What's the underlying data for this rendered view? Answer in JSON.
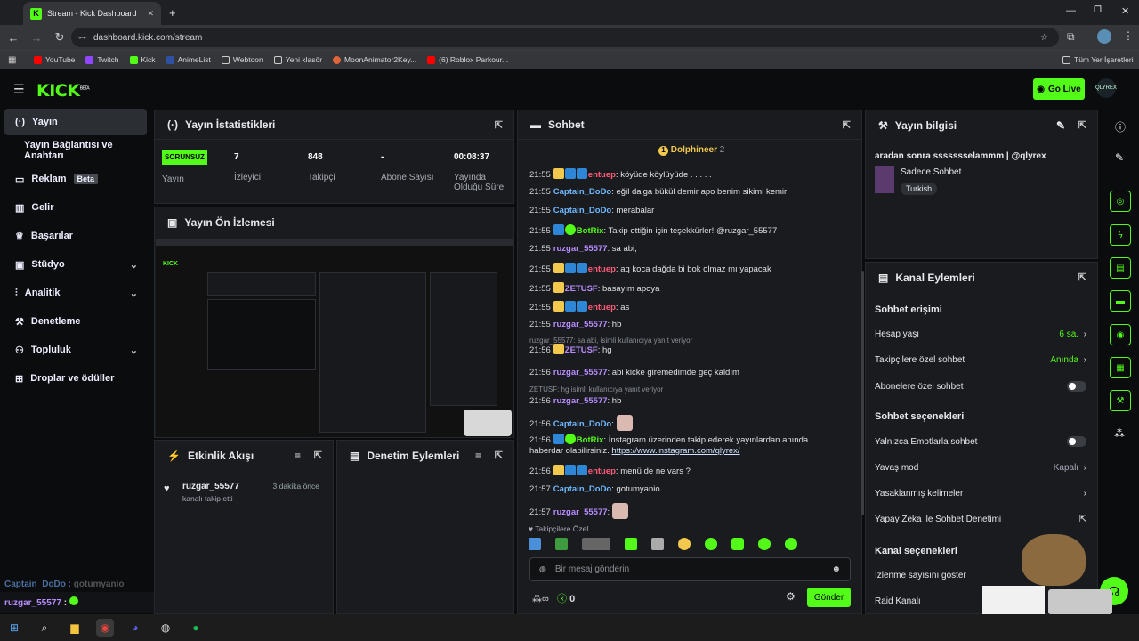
{
  "browser": {
    "tab_title": "Stream - Kick Dashboard",
    "url": "dashboard.kick.com/stream",
    "bookmarks": [
      {
        "label": "YouTube",
        "color": "#ff0000"
      },
      {
        "label": "Twitch",
        "color": "#9146ff"
      },
      {
        "label": "Kick",
        "color": "#53fc18"
      },
      {
        "label": "AnimeList",
        "color": "#2e51a2"
      },
      {
        "label": "Webtoon",
        "color": "#cccccc"
      },
      {
        "label": "Yeni klasör",
        "color": "#cccccc"
      },
      {
        "label": "MoonAnimator2Key...",
        "color": "#e0663a"
      },
      {
        "label": "(6) Roblox Parkour...",
        "color": "#ff0000"
      }
    ],
    "all_bookmarks": "Tüm Yer İşaretleri"
  },
  "header": {
    "logo": "KICK",
    "logo_sup": "BETA",
    "go_live": "Go Live",
    "avatar": "QLYREX"
  },
  "sidebar": {
    "items": [
      {
        "label": "Yayın",
        "icon": "broadcast-icon"
      },
      {
        "label": "Yayın Bağlantısı ve Anahtarı",
        "icon": ""
      },
      {
        "label": "Reklam",
        "icon": "ad-icon",
        "beta": "Beta"
      },
      {
        "label": "Gelir",
        "icon": "chart-icon"
      },
      {
        "label": "Başarılar",
        "icon": "trophy-icon"
      },
      {
        "label": "Stüdyo",
        "icon": "studio-icon"
      },
      {
        "label": "Analitik",
        "icon": "analytics-icon"
      },
      {
        "label": "Denetleme",
        "icon": "wrench-icon"
      },
      {
        "label": "Topluluk",
        "icon": "community-icon"
      },
      {
        "label": "Droplar ve ödüller",
        "icon": "gift-icon"
      }
    ],
    "chat_overlay": [
      {
        "user": "Captain_DoDo",
        "text": "gotumyanio"
      },
      {
        "user": "ruzgar_55577",
        "text": ":"
      }
    ]
  },
  "stats": {
    "title": "Yayın İstatistikleri",
    "status_badge": "SORUNSUZ",
    "status_label": "Yayın",
    "viewers": "7",
    "viewers_label": "İzleyici",
    "followers": "848",
    "followers_label": "Takipçi",
    "subs": "-",
    "subs_label": "Abone Sayısı",
    "duration": "00:08:37",
    "duration_label": "Yayında Olduğu Süre"
  },
  "preview": {
    "title": "Yayın Ön İzlemesi"
  },
  "activity": {
    "title": "Etkinlik Akışı",
    "events": [
      {
        "user": "ruzgar_55577",
        "action": "kanalı takip etti",
        "time": "3 dakika önce"
      }
    ]
  },
  "moderation": {
    "title": "Denetim Eylemleri"
  },
  "chat": {
    "title": "Sohbet",
    "pinned_user": "Dolphineer",
    "pinned_count": "2",
    "pinned_rank": "1",
    "messages": [
      {
        "time": "21:55",
        "user": "entuep",
        "text": "köyüde köylüyüde . . . . . .",
        "cls": "u1"
      },
      {
        "time": "21:55",
        "user": "Captain_DoDo",
        "text": "eğil dalga bükül demir apo benim sikimi kemir",
        "cls": "u2"
      },
      {
        "time": "21:55",
        "user": "Captain_DoDo",
        "text": "merabalar",
        "cls": "u2"
      },
      {
        "time": "21:55",
        "user": "BotRix",
        "text": "Takip ettiğin için teşekkürler! @ruzgar_55577",
        "cls": "u4"
      },
      {
        "time": "21:55",
        "user": "ruzgar_55577",
        "text": "sa abi,",
        "cls": "u3"
      },
      {
        "time": "21:55",
        "user": "entuep",
        "text": "aq koca dağda bi bok olmaz mı yapacak",
        "cls": "u1"
      },
      {
        "time": "21:55",
        "user": "ZETUSF",
        "text": "basayım apoya",
        "cls": "u3"
      },
      {
        "time": "21:55",
        "user": "entuep",
        "text": "as",
        "cls": "u1"
      },
      {
        "time": "21:55",
        "user": "ruzgar_55577",
        "text": "hb",
        "cls": "u3"
      },
      {
        "time": "21:56",
        "user": "ZETUSF",
        "text": "hg",
        "cls": "u3",
        "reply": "ruzgar_55577: sa abi, isimli kullanıcıya yanıt veriyor"
      },
      {
        "time": "21:56",
        "user": "ruzgar_55577",
        "text": "abi kicke giremedimde geç kaldım",
        "cls": "u3"
      },
      {
        "time": "21:56",
        "user": "ruzgar_55577",
        "text": "hb",
        "cls": "u3",
        "reply": "ZETUSF: hg isimli kullanıcıya yanıt veriyor"
      },
      {
        "time": "21:56",
        "user": "Captain_DoDo",
        "text": "",
        "cls": "u2"
      },
      {
        "time": "21:56",
        "user": "BotRix",
        "text": "İnstagram üzerinden takip ederek yayınlardan anında",
        "cls": "u4"
      },
      {
        "time": "21:56",
        "user": "entuep",
        "text": "menü de ne vars ?",
        "cls": "u1"
      },
      {
        "time": "21:57",
        "user": "Captain_DoDo",
        "text": "gotumyanio",
        "cls": "u2"
      },
      {
        "time": "21:57",
        "user": "ruzgar_55577",
        "text": "",
        "cls": "u3"
      }
    ],
    "botrix_cont": "haberdar olabilirsiniz.",
    "botrix_link": "https://www.instagram.com/qlyrex/",
    "followers_only": "Takipçilere Özel",
    "placeholder": "Bir mesaj gönderin",
    "points": "0",
    "send": "Gönder"
  },
  "info": {
    "title": "Yayın bilgisi",
    "stream_title": "aradan sonra ssssssselammm | @qlyrex",
    "category": "Sadece Sohbet",
    "tag": "Turkish"
  },
  "actions": {
    "title": "Kanal Eylemleri",
    "chat_access": "Sohbet erişimi",
    "account_age": "Hesap yaşı",
    "account_age_val": "6 sa.",
    "followers_chat": "Takipçilere özel sohbet",
    "followers_chat_val": "Anında",
    "subs_chat": "Abonelere özel sohbet",
    "chat_options": "Sohbet seçenekleri",
    "emotes_only": "Yalnızca Emotlarla sohbet",
    "slow_mode": "Yavaş mod",
    "slow_mode_val": "Kapalı",
    "banned_words": "Yasaklanmış kelimeler",
    "ai_mod": "Yapay Zeka ile Sohbet Denetimi",
    "channel_options": "Kanal seçenekleri",
    "show_views": "İzlenme sayısını göster",
    "raid": "Raid Kanalı"
  },
  "colors": {
    "accent": "#53fc18",
    "panel": "#191b1f",
    "bg": "#0b0c0e"
  }
}
